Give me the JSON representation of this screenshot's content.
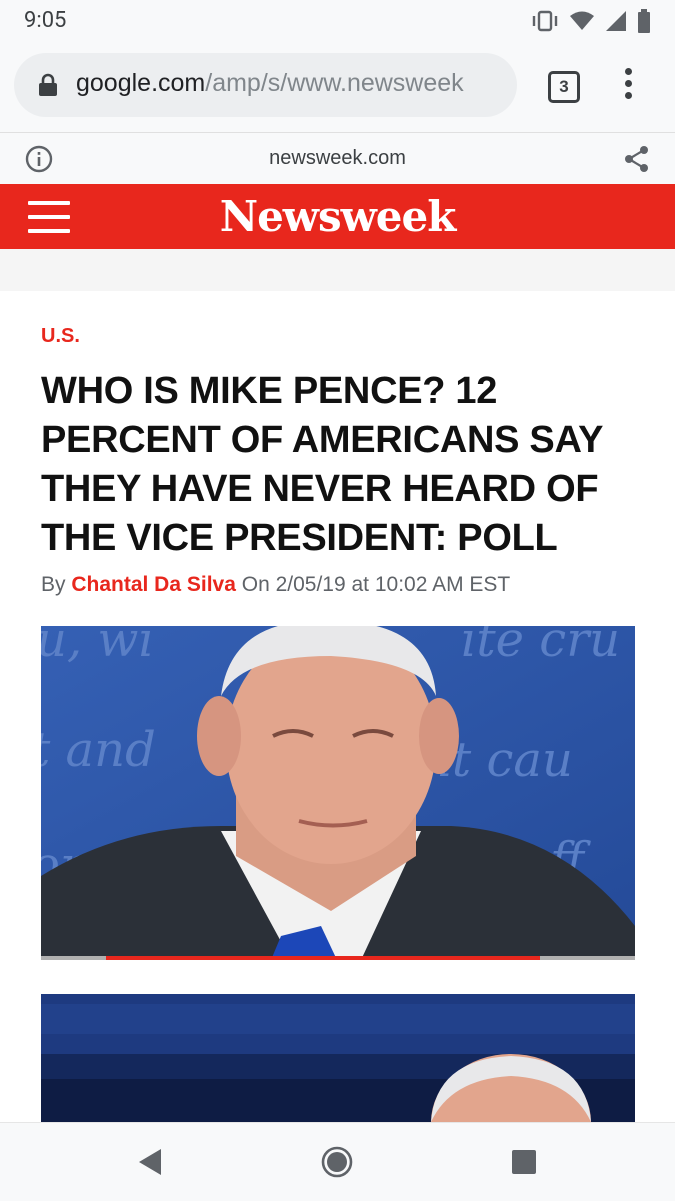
{
  "status_bar": {
    "time": "9:05",
    "icons": [
      "vibrate-icon",
      "wifi-icon",
      "signal-icon",
      "battery-icon"
    ]
  },
  "browser": {
    "url_host": "google.com",
    "url_path": "/amp/s/www.newsweek",
    "tab_count": "3",
    "icons": [
      "lock-icon",
      "tab-switcher-icon",
      "more-menu-icon"
    ]
  },
  "amp_bar": {
    "domain": "newsweek.com",
    "icons": [
      "info-icon",
      "share-icon"
    ]
  },
  "site_header": {
    "logo": "Newsweek",
    "brand_color": "#e8271d",
    "icons": [
      "hamburger-menu-icon"
    ]
  },
  "article": {
    "category": "U.S.",
    "headline": "WHO IS MIKE PENCE? 12 PERCENT OF AMERICANS SAY THEY HAVE NEVER HEARD OF THE VICE PRESIDENT: POLL",
    "byline_prefix": "By ",
    "author": "Chantal Da Silva",
    "date_text": " On 2/05/19 at 10:02 AM EST",
    "video_progress": 0.82
  },
  "nav_bar": {
    "icons": [
      "back-icon",
      "home-icon",
      "recents-icon"
    ]
  }
}
